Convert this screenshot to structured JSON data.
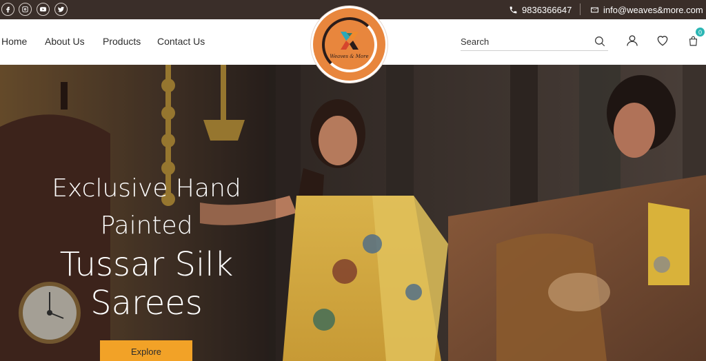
{
  "topbar": {
    "social": [
      {
        "name": "facebook-icon"
      },
      {
        "name": "instagram-icon"
      },
      {
        "name": "youtube-icon"
      },
      {
        "name": "twitter-icon"
      }
    ],
    "phone": "9836366647",
    "email": "info@weaves&more.com"
  },
  "nav": {
    "items": [
      "Home",
      "About Us",
      "Products",
      "Contact Us"
    ],
    "search_placeholder": "Search",
    "cart_count": "0"
  },
  "logo": {
    "text": "Weaves & More"
  },
  "hero": {
    "line1": "Exclusive Hand",
    "line2": "Painted",
    "line3": "Tussar Silk",
    "line4": "Sarees",
    "cta": "Explore"
  },
  "colors": {
    "topbar_bg": "#3a2e29",
    "accent_orange": "#e8863d",
    "cta_bg": "#f2a227",
    "badge_teal": "#2bb6b4"
  }
}
